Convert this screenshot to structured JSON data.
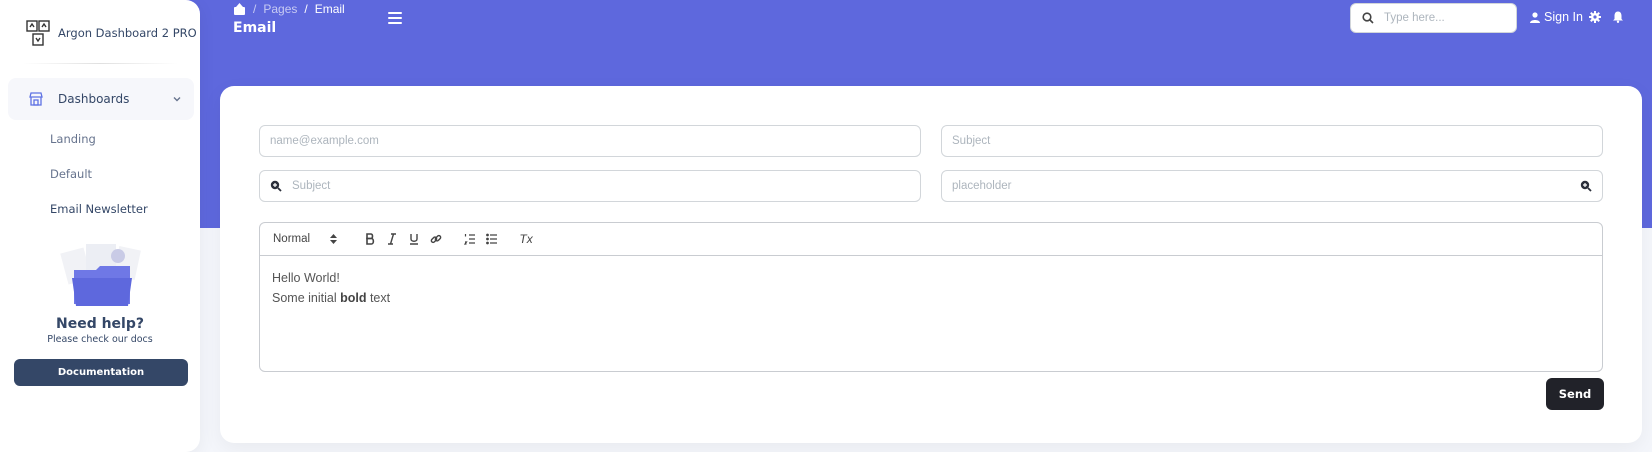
{
  "brand": {
    "name": "Argon Dashboard 2 PRO"
  },
  "sidebar": {
    "section": {
      "label": "Dashboards",
      "icon": "shop-icon"
    },
    "items": [
      {
        "label": "Landing"
      },
      {
        "label": "Default"
      },
      {
        "label": "Email Newsletter"
      }
    ],
    "help": {
      "title": "Need help?",
      "subtitle": "Please check our docs",
      "button": "Documentation"
    }
  },
  "topnav": {
    "breadcrumb": [
      "Pages",
      "Email"
    ],
    "title": "Email",
    "search_placeholder": "Type here...",
    "signin": "Sign In"
  },
  "form": {
    "email_placeholder": "name@example.com",
    "subject_placeholder": "Subject",
    "subject2_placeholder": "Subject",
    "generic_placeholder": "placeholder"
  },
  "editor": {
    "heading_select": "Normal",
    "clear_format": "Tx",
    "line1": "Hello World!",
    "line2_prefix": "Some initial ",
    "line2_bold": "bold",
    "line2_suffix": " text"
  },
  "send_button": "Send",
  "colors": {
    "accent": "#5e68dd",
    "dark": "#212229",
    "text": "#344767"
  }
}
